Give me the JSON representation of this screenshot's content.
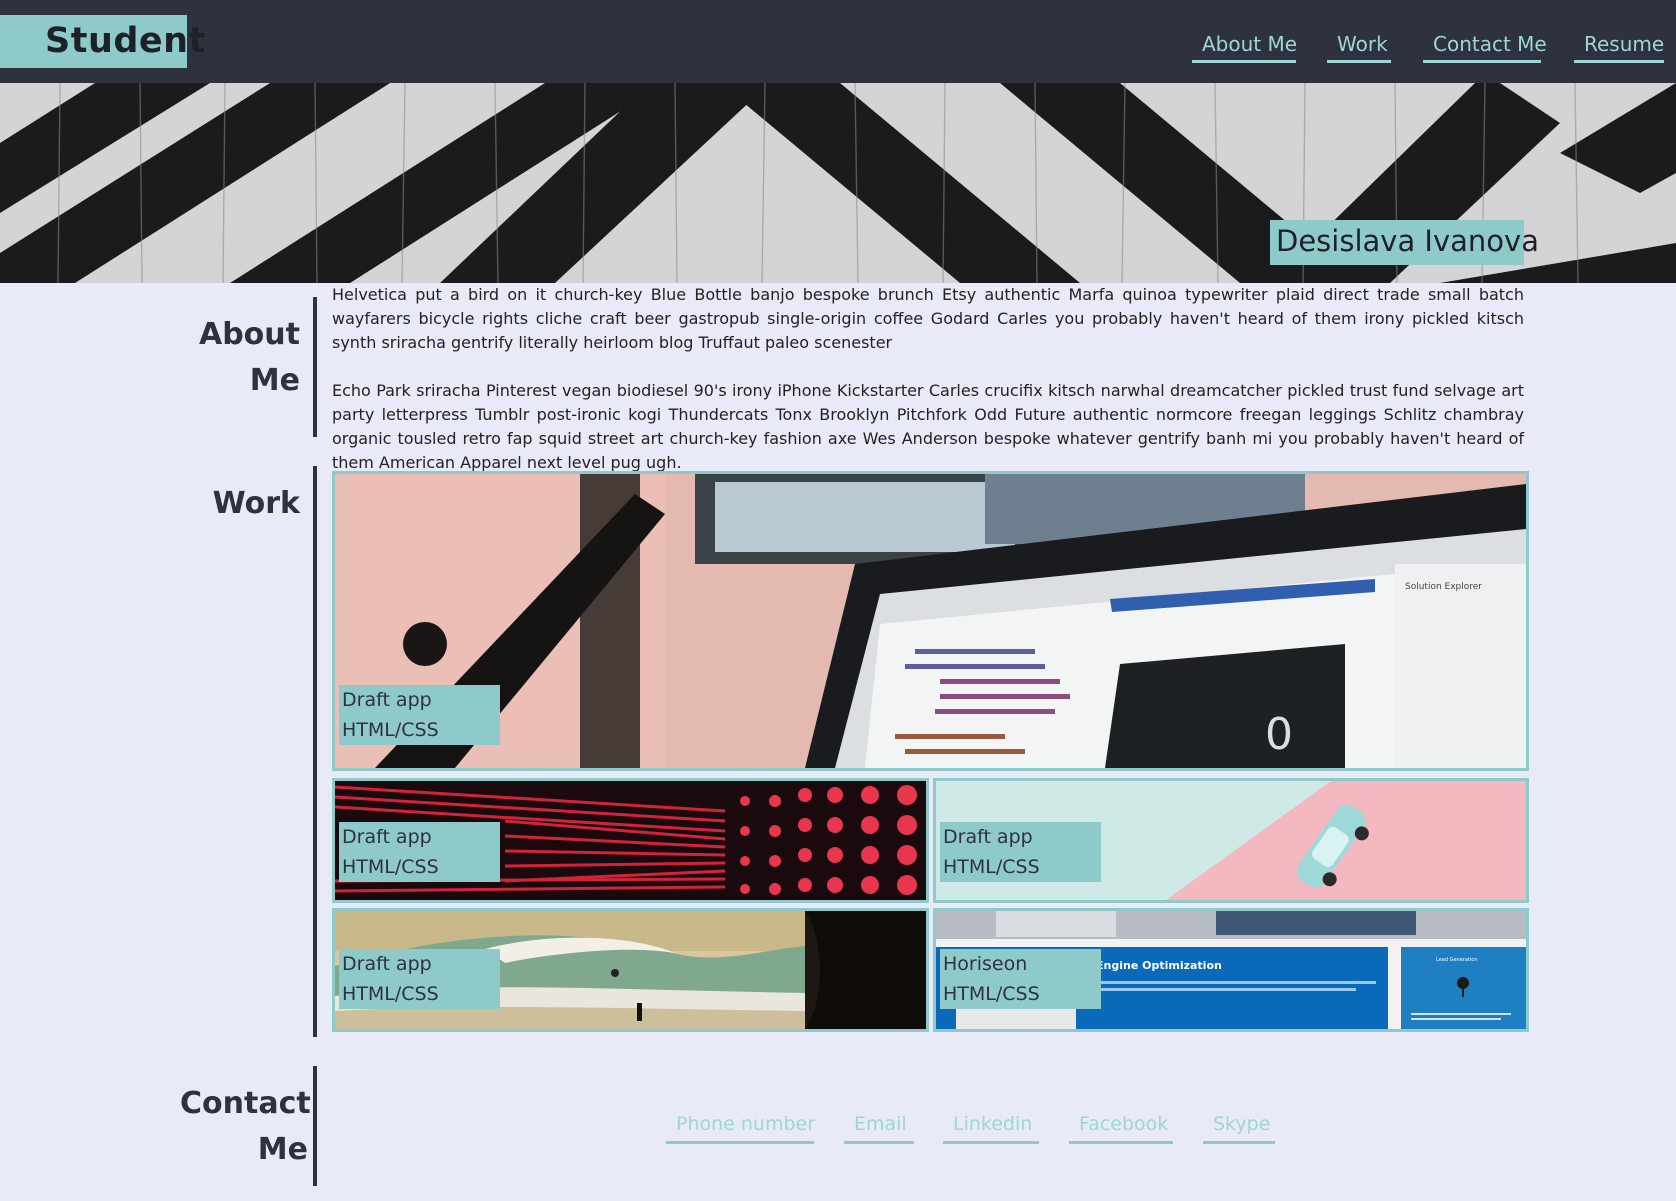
{
  "header": {
    "brand": "Student",
    "nav": [
      "About Me",
      "Work",
      "Contact Me",
      "Resume"
    ]
  },
  "hero": {
    "name": "Desislava Ivanova"
  },
  "about": {
    "title_line1": "About",
    "title_line2": "Me",
    "paragraph1": "Helvetica put a bird on it church-key Blue Bottle banjo bespoke brunch Etsy authentic Marfa quinoa typewriter plaid direct trade small batch wayfarers bicycle rights cliche craft beer gastropub single-origin coffee Godard Carles you probably haven't heard of them irony pickled kitsch synth sriracha gentrify literally heirloom blog Truffaut paleo scenester",
    "paragraph2": "Echo Park sriracha Pinterest vegan biodiesel 90's irony iPhone Kickstarter Carles crucifix kitsch narwhal dreamcatcher pickled trust fund selvage art party letterpress Tumblr post-ironic kogi Thundercats Tonx Brooklyn Pitchfork Odd Future authentic normcore freegan leggings Schlitz chambray organic tousled retro fap squid street art church-key fashion axe Wes Anderson bespoke whatever gentrify banh mi you probably haven't heard of them American Apparel next level pug ugh."
  },
  "work": {
    "title": "Work",
    "projects": [
      {
        "name": "Draft app",
        "tech": "HTML/CSS",
        "image": "laptop-code-editor"
      },
      {
        "name": "Draft app",
        "tech": "HTML/CSS",
        "image": "red-led-wall"
      },
      {
        "name": "Draft app",
        "tech": "HTML/CSS",
        "image": "toy-car-pastel"
      },
      {
        "name": "Draft app",
        "tech": "HTML/CSS",
        "image": "surfer-wave"
      },
      {
        "name": "Horiseon",
        "tech": "HTML/CSS",
        "image": "horiseon-site"
      }
    ],
    "horiseon_heading": "Engine Optimization",
    "horiseon_side": "Lead Generation",
    "editor_zero": "0",
    "editor_panel": "Solution Explorer"
  },
  "contact": {
    "title_line1": "Contact",
    "title_line2": "Me",
    "links": [
      "Phone number",
      "Email",
      "Linkedin",
      "Facebook",
      "Skype"
    ]
  },
  "colors": {
    "accent": "#8fcaca",
    "link": "#9dd6d6",
    "header_bg": "#2e313e",
    "page_bg": "#e8eaf7"
  }
}
